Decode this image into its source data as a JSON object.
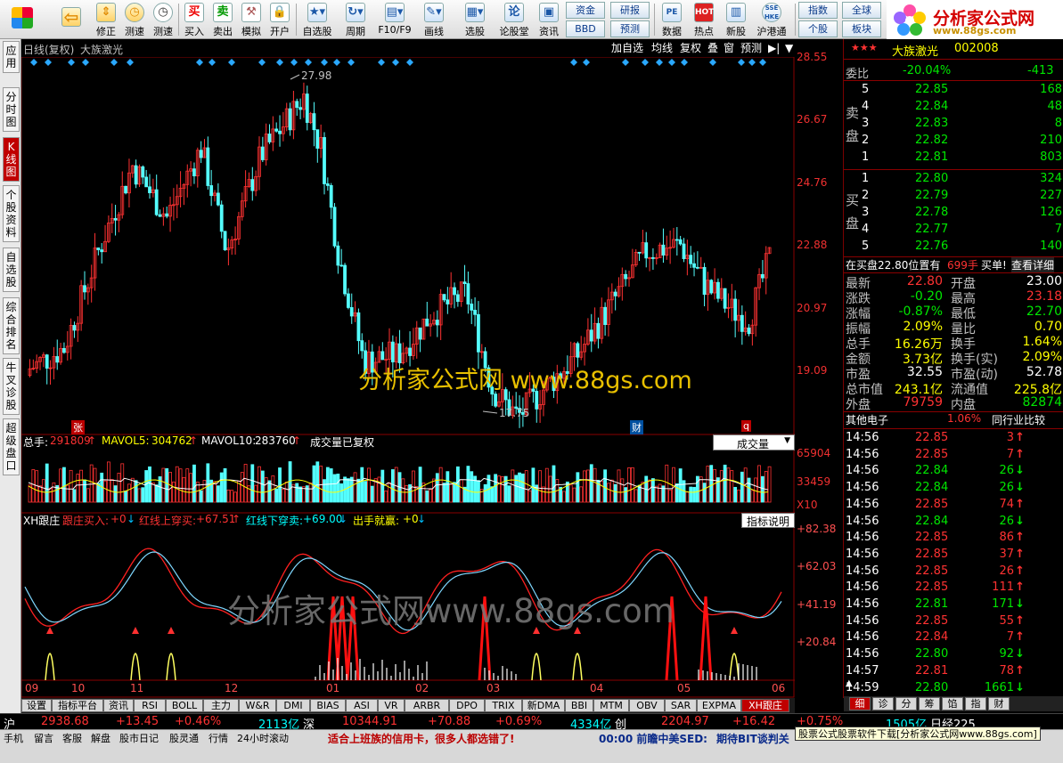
{
  "toolbar": {
    "buttons": [
      {
        "label": "",
        "icon": "windows-icon"
      },
      {
        "label": "",
        "icon": "back-arrow-icon"
      },
      {
        "label": "修正",
        "icon": "up-down-arrows-icon"
      },
      {
        "label": "测速",
        "icon": "clock-icon"
      },
      {
        "label": "买入",
        "icon": "buy-icon"
      },
      {
        "label": "卖出",
        "icon": "sell-icon"
      },
      {
        "label": "模拟",
        "icon": "hammer-icon"
      },
      {
        "label": "开户",
        "icon": "lock-icon"
      },
      {
        "label": "自选股",
        "icon": "star-icon"
      },
      {
        "label": "周期",
        "icon": "cycle-icon"
      },
      {
        "label": "F10/F9",
        "icon": "f10-icon"
      },
      {
        "label": "画线",
        "icon": "pen-icon"
      },
      {
        "label": "选股",
        "icon": "select-stock-icon"
      },
      {
        "label": "论股堂",
        "icon": "discuss-icon"
      },
      {
        "label": "资讯",
        "icon": "news-icon"
      },
      {
        "label": "数据",
        "icon": "pe-icon"
      },
      {
        "label": "热点",
        "icon": "hot-icon"
      },
      {
        "label": "新股",
        "icon": "new-stock-icon"
      },
      {
        "label": "沪港通",
        "icon": "sse-hk-icon"
      }
    ],
    "small_buttons": [
      "资金",
      "研报",
      "BBD",
      "预测",
      "指数",
      "全球",
      "个股",
      "板块"
    ],
    "logo_title": "分析家公式网",
    "logo_url": "www.88gs.com"
  },
  "left_tabs": [
    "应用",
    "分时图",
    "K线图",
    "个股资料",
    "自选股",
    "综合排名",
    "牛叉诊股",
    "超级盘口"
  ],
  "chart": {
    "header_title": "日线(复权)",
    "stock_name": "大族激光",
    "header_buttons": [
      "加自选",
      "均线",
      "复权",
      "叠",
      "窗",
      "预测",
      "▶|",
      "▼"
    ],
    "price_axis": [
      "28.55",
      "26.67",
      "24.76",
      "22.88",
      "20.97",
      "19.09"
    ],
    "high_label": "27.98",
    "low_label": "17.75",
    "event_markers": [
      "张",
      "财",
      "q"
    ],
    "volume": {
      "total_label": "总手:",
      "total_value": "291809",
      "mavol5_label": "MAVOL5:",
      "mavol5_value": "304762",
      "mavol10_label": "MAVOL10:",
      "mavol10_value": "283760",
      "note": "成交量已复权",
      "selector": "成交量",
      "axis": [
        "65904",
        "33459",
        "X10"
      ]
    },
    "indicator": {
      "name": "XH跟庄",
      "items": [
        {
          "label": "跟庄买入:",
          "value": "+0"
        },
        {
          "label": "红线上穿买:",
          "value": "+67.51"
        },
        {
          "label": "红线下穿卖:",
          "value": "+69.00"
        },
        {
          "label": "出手就赢:",
          "value": "+0"
        }
      ],
      "help": "指标说明",
      "axis": [
        "+82.38",
        "+62.03",
        "+41.19",
        "+20.84"
      ]
    },
    "date_axis": [
      "09",
      "10",
      "11",
      "12",
      "01",
      "02",
      "03",
      "04",
      "05",
      "06"
    ],
    "watermark_main": "分析家公式网  www.88gs.com",
    "watermark_indicator": "分析家公式网www.88gs.com"
  },
  "bottom_tabs": [
    "设置",
    "指标平台",
    "资讯",
    "RSI",
    "BOLL",
    "主力",
    "W&R",
    "DMI",
    "BIAS",
    "ASI",
    "VR",
    "ARBR",
    "DPO",
    "TRIX",
    "新DMA",
    "BBI",
    "MTM",
    "OBV",
    "SAR",
    "EXPMA",
    "XH跟庄"
  ],
  "quote": {
    "title": "大族激光",
    "code": "002008",
    "weibi_label": "委比",
    "weibi_value": "-20.04%",
    "weicha_value": "-413",
    "sell_label": "卖盘",
    "buy_label": "买盘",
    "sells": [
      {
        "lvl": "5",
        "price": "22.85",
        "vol": "168"
      },
      {
        "lvl": "4",
        "price": "22.84",
        "vol": "48"
      },
      {
        "lvl": "3",
        "price": "22.83",
        "vol": "8"
      },
      {
        "lvl": "2",
        "price": "22.82",
        "vol": "210"
      },
      {
        "lvl": "1",
        "price": "22.81",
        "vol": "803"
      }
    ],
    "buys": [
      {
        "lvl": "1",
        "price": "22.80",
        "vol": "324"
      },
      {
        "lvl": "2",
        "price": "22.79",
        "vol": "227"
      },
      {
        "lvl": "3",
        "price": "22.78",
        "vol": "126"
      },
      {
        "lvl": "4",
        "price": "22.77",
        "vol": "7"
      },
      {
        "lvl": "5",
        "price": "22.76",
        "vol": "140"
      }
    ],
    "notice_text": "在买盘22.80位置有",
    "notice_vol": "699手",
    "notice_tail": "买单!",
    "notice_link": "查看详细",
    "stats": [
      {
        "l1": "最新",
        "v1": "22.80",
        "c1": "red",
        "l2": "开盘",
        "v2": "23.00",
        "c2": "wht"
      },
      {
        "l1": "涨跌",
        "v1": "-0.20",
        "c1": "grn",
        "l2": "最高",
        "v2": "23.18",
        "c2": "red"
      },
      {
        "l1": "涨幅",
        "v1": "-0.87%",
        "c1": "grn",
        "l2": "最低",
        "v2": "22.70",
        "c2": "grn"
      },
      {
        "l1": "振幅",
        "v1": "2.09%",
        "c1": "yel",
        "l2": "量比",
        "v2": "0.70",
        "c2": "yel"
      },
      {
        "l1": "总手",
        "v1": "16.26万",
        "c1": "yel",
        "l2": "换手",
        "v2": "1.64%",
        "c2": "yel"
      },
      {
        "l1": "金额",
        "v1": "3.73亿",
        "c1": "yel",
        "l2": "换手(实)",
        "v2": "2.09%",
        "c2": "yel"
      },
      {
        "l1": "市盈",
        "v1": "32.55",
        "c1": "wht",
        "l2": "市盈(动)",
        "v2": "52.78",
        "c2": "wht"
      },
      {
        "l1": "总市值",
        "v1": "243.1亿",
        "c1": "yel",
        "l2": "流通值",
        "v2": "225.8亿",
        "c2": "yel"
      },
      {
        "l1": "外盘",
        "v1": "79759",
        "c1": "red",
        "l2": "内盘",
        "v2": "82874",
        "c2": "grn"
      }
    ],
    "industry_label": "其他电子",
    "industry_value": "1.06%",
    "industry_link": "同行业比较",
    "ticks": [
      {
        "t": "14:56",
        "p": "22.85",
        "v": "3",
        "d": "up"
      },
      {
        "t": "14:56",
        "p": "22.85",
        "v": "7",
        "d": "up"
      },
      {
        "t": "14:56",
        "p": "22.84",
        "v": "26",
        "d": "down"
      },
      {
        "t": "14:56",
        "p": "22.84",
        "v": "26",
        "d": "down"
      },
      {
        "t": "14:56",
        "p": "22.85",
        "v": "74",
        "d": "up"
      },
      {
        "t": "14:56",
        "p": "22.84",
        "v": "26",
        "d": "down"
      },
      {
        "t": "14:56",
        "p": "22.85",
        "v": "86",
        "d": "up"
      },
      {
        "t": "14:56",
        "p": "22.85",
        "v": "37",
        "d": "up"
      },
      {
        "t": "14:56",
        "p": "22.85",
        "v": "26",
        "d": "up"
      },
      {
        "t": "14:56",
        "p": "22.85",
        "v": "111",
        "d": "up"
      },
      {
        "t": "14:56",
        "p": "22.81",
        "v": "171",
        "d": "down"
      },
      {
        "t": "14:56",
        "p": "22.85",
        "v": "55",
        "d": "up"
      },
      {
        "t": "14:56",
        "p": "22.84",
        "v": "7",
        "d": "up"
      },
      {
        "t": "14:56",
        "p": "22.80",
        "v": "92",
        "d": "down"
      },
      {
        "t": "14:57",
        "p": "22.81",
        "v": "78",
        "d": "up"
      },
      {
        "t": "14:59",
        "p": "22.80",
        "v": "1661",
        "d": "down"
      }
    ],
    "side_tabs": [
      "细",
      "诊",
      "分",
      "筹",
      "馅",
      "指",
      "财"
    ]
  },
  "status": {
    "sh_label": "沪",
    "sh_index": "2938.68",
    "sh_change": "+13.45",
    "sh_pct": "+0.46%",
    "sh_amount": "2113亿",
    "sz_label": "深",
    "sz_index": "10344.91",
    "sz_change": "+70.88",
    "sz_pct": "+0.69%",
    "sz_amount": "4334亿",
    "cy_label": "创",
    "cy_index": "2204.97",
    "cy_change": "+16.42",
    "cy_pct": "+0.75%",
    "extra_amount": "1505亿",
    "extra_label": "日经225"
  },
  "status2": {
    "buttons": [
      "手机",
      "留言",
      "客服",
      "解盘",
      "股市日记",
      "股灵通",
      "行情",
      "24小时滚动"
    ],
    "ticker1": "适合上班族的信用卡，很多人都选错了!",
    "ticker2": "00:00 前瞻中美SED:",
    "ticker3": "期待BIT谈判关",
    "tooltip": "股票公式股票软件下载[分析家公式网www.88gs.com]"
  }
}
